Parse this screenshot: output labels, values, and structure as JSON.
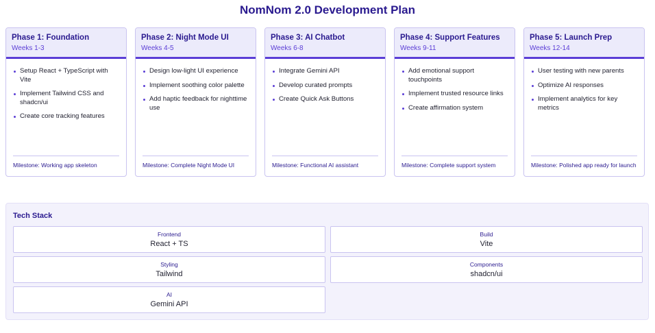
{
  "title": "NomNom 2.0 Development Plan",
  "phases": [
    {
      "title": "Phase 1: Foundation",
      "weeks": "Weeks 1-3",
      "tasks": [
        "Setup React + TypeScript with Vite",
        "Implement Tailwind CSS and shadcn/ui",
        "Create core tracking features"
      ],
      "milestone": "Milestone: Working app skeleton"
    },
    {
      "title": "Phase 2: Night Mode UI",
      "weeks": "Weeks 4-5",
      "tasks": [
        "Design low-light UI experience",
        "Implement soothing color palette",
        "Add haptic feedback for nighttime use"
      ],
      "milestone": "Milestone: Complete Night Mode UI"
    },
    {
      "title": "Phase 3: AI Chatbot",
      "weeks": "Weeks 6-8",
      "tasks": [
        "Integrate Gemini API",
        "Develop curated prompts",
        "Create Quick Ask Buttons"
      ],
      "milestone": "Milestone: Functional AI assistant"
    },
    {
      "title": "Phase 4: Support Features",
      "weeks": "Weeks 9-11",
      "tasks": [
        "Add emotional support touchpoints",
        "Implement trusted resource links",
        "Create affirmation system"
      ],
      "milestone": "Milestone: Complete support system"
    },
    {
      "title": "Phase 5: Launch Prep",
      "weeks": "Weeks 12-14",
      "tasks": [
        "User testing with new parents",
        "Optimize AI responses",
        "Implement analytics for key metrics"
      ],
      "milestone": "Milestone: Polished app ready for launch"
    }
  ],
  "tech_stack": {
    "title": "Tech Stack",
    "items": [
      {
        "category": "Frontend",
        "value": "React + TS"
      },
      {
        "category": "Build",
        "value": "Vite"
      },
      {
        "category": "Styling",
        "value": "Tailwind"
      },
      {
        "category": "Components",
        "value": "shadcn/ui"
      },
      {
        "category": "AI",
        "value": "Gemini API"
      }
    ]
  }
}
